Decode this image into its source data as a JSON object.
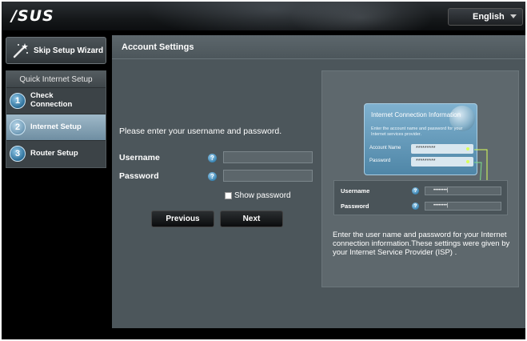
{
  "header": {
    "logo": "/SUS",
    "language": "English"
  },
  "sidebar": {
    "skip_wizard": "Skip Setup Wizard",
    "section_title": "Quick Internet Setup",
    "steps": [
      {
        "num": "1",
        "label_line1": "Check",
        "label_line2": "Connection",
        "active": false
      },
      {
        "num": "2",
        "label_line1": "Internet Setup",
        "label_line2": "",
        "active": true
      },
      {
        "num": "3",
        "label_line1": "Router Setup",
        "label_line2": "",
        "active": false
      }
    ]
  },
  "main": {
    "title": "Account Settings",
    "prompt": "Please enter your username and password.",
    "username_label": "Username",
    "password_label": "Password",
    "help_glyph": "?",
    "username_value": "",
    "password_value": "",
    "show_password_label": "Show password",
    "show_password_checked": false,
    "previous_label": "Previous",
    "next_label": "Next"
  },
  "illustration": {
    "card_title": "Internet Connection Information",
    "card_desc": "Enter the account name and password for your Internet services provider.",
    "account_name_label": "Account Name",
    "password_label": "Password",
    "masked_value_1": "*********",
    "masked_value_2": "*********",
    "mini_username_label": "Username",
    "mini_password_label": "Password",
    "mini_value_1": "••••••••|",
    "mini_value_2": "••••••••|",
    "description": "Enter the user name and password for your Internet connection information.These settings were given by your Internet Service Provider (ISP) ."
  },
  "colors": {
    "accent_active": "#8aa9bd",
    "panel": "#4c565b",
    "highlight": "#d9ff5a"
  }
}
